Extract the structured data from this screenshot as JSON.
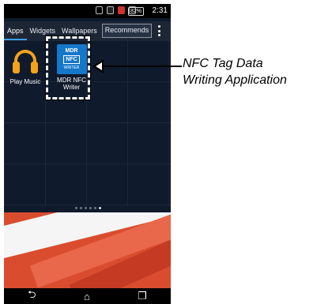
{
  "status_bar": {
    "battery": "82%",
    "time": "2:31"
  },
  "tabs": [
    "Apps",
    "Widgets",
    "Wallpapers",
    "Recommends"
  ],
  "apps": [
    {
      "name": "Play Music"
    },
    {
      "name": "MDR NFC Writer",
      "icon_line1": "MDR",
      "icon_line2": "NFC",
      "icon_line3": "WRITER"
    }
  ],
  "pager": {
    "pages": 6,
    "active": 6
  },
  "callout": {
    "line1": "NFC Tag Data",
    "line2": "Writing Application"
  }
}
